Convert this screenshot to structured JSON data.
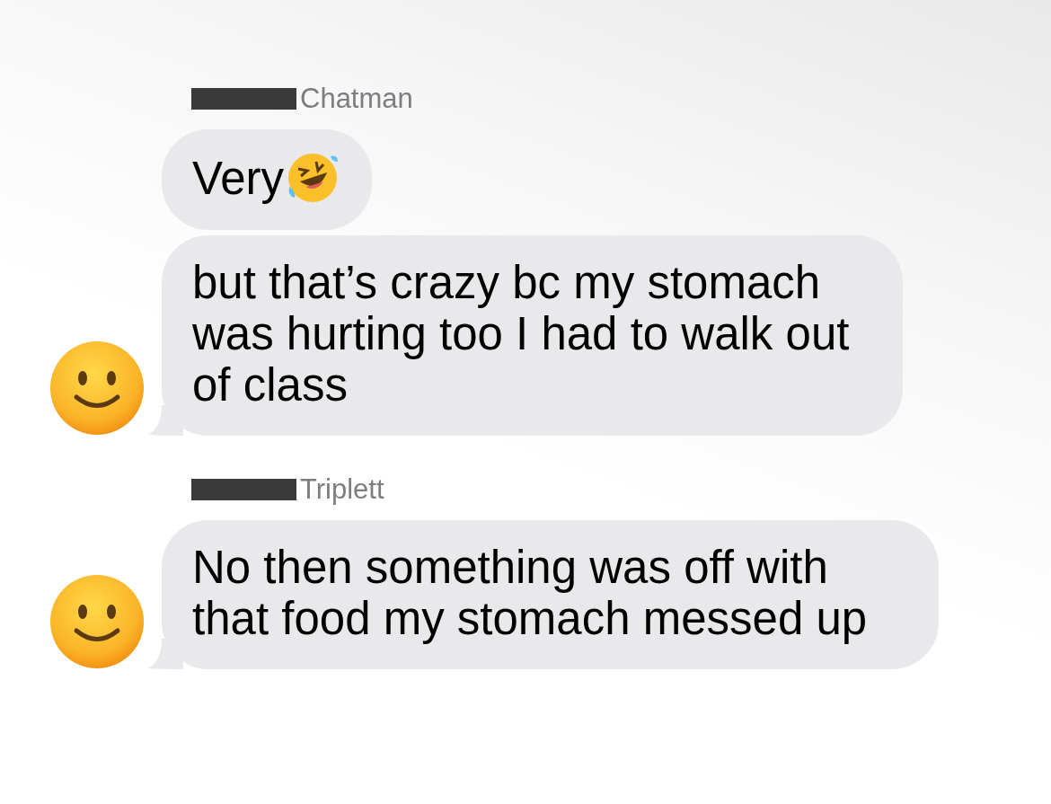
{
  "groups": [
    {
      "sender": "Chatman",
      "name_redacted": true,
      "messages": [
        {
          "kind": "emoji_text",
          "text": "Very",
          "tail": false
        },
        {
          "kind": "text",
          "text": "but that’s crazy bc my stomach was hurting too I had to walk out of class",
          "tail": true
        }
      ]
    },
    {
      "sender": "Triplett",
      "name_redacted": true,
      "messages": [
        {
          "kind": "text",
          "text": "No then something was off with that food my stomach messed up",
          "tail": true
        }
      ]
    }
  ]
}
